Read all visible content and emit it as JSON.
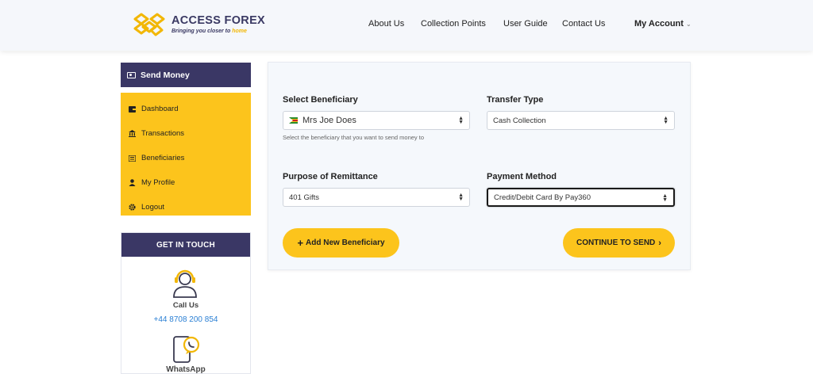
{
  "brand": {
    "name": "ACCESS FOREX",
    "tagline_start": "Bringing you closer to ",
    "tagline_highlight": "home"
  },
  "nav": {
    "items": [
      "About Us",
      "Collection Points",
      "User Guide",
      "Contact Us"
    ],
    "account": "My Account",
    "account_icon": "chevron-down-icon"
  },
  "sidebar": {
    "header": "Send Money",
    "header_icon": "money-icon",
    "items": [
      {
        "label": "Dashboard",
        "icon": "wallet-icon"
      },
      {
        "label": "Transactions",
        "icon": "bank-icon"
      },
      {
        "label": "Beneficiaries",
        "icon": "address-book-icon"
      },
      {
        "label": "My Profile",
        "icon": "user-icon"
      },
      {
        "label": "Logout",
        "icon": "gear-icon"
      }
    ]
  },
  "contact": {
    "header": "GET IN TOUCH",
    "call_label": "Call Us",
    "phone": "+44 8708 200 854",
    "whatsapp_label": "WhatsApp"
  },
  "form": {
    "beneficiary_label": "Select Beneficiary",
    "beneficiary_value": "Mrs Joe Does",
    "beneficiary_help": "Select the beneficiary that you want to send money to",
    "transfer_type_label": "Transfer Type",
    "transfer_type_value": "Cash Collection",
    "purpose_label": "Purpose of Remittance",
    "purpose_value": "401 Gifts",
    "payment_label": "Payment Method",
    "payment_value": "Credit/Debit Card By Pay360",
    "add_button": "Add New Beneficiary",
    "continue_button": "CONTINUE TO SEND"
  },
  "colors": {
    "brand_navy": "#3a3765",
    "brand_yellow": "#fcc41c",
    "link_blue": "#2a7fd4"
  }
}
